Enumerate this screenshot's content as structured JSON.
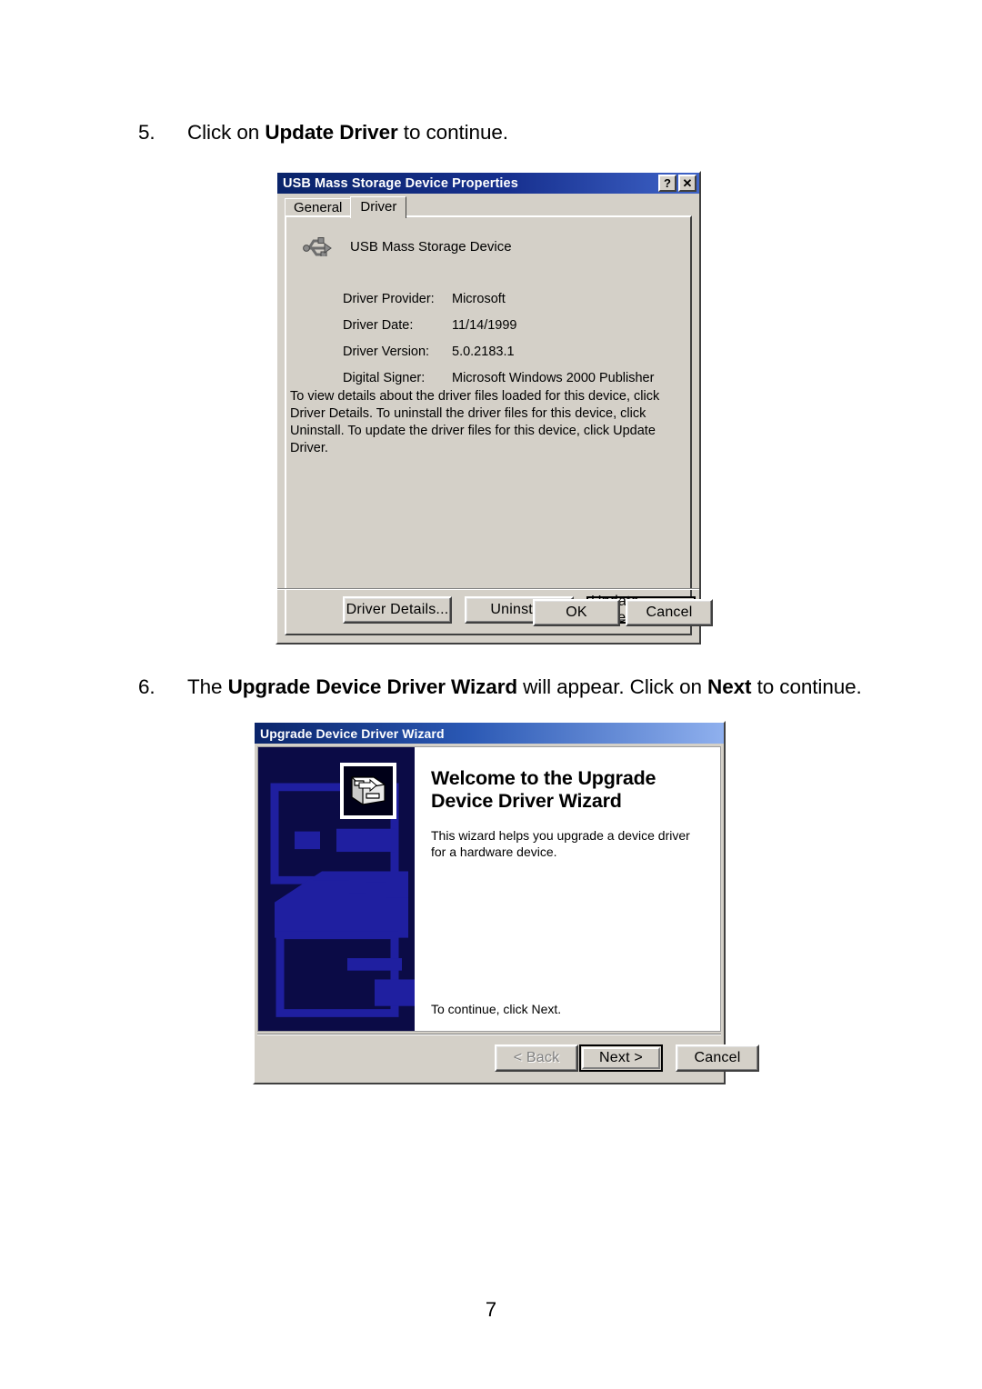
{
  "document": {
    "steps": [
      {
        "number": "5.",
        "parts": [
          {
            "text": "Click on ",
            "bold": false
          },
          {
            "text": "Update Driver",
            "bold": true
          },
          {
            "text": " to continue.",
            "bold": false
          }
        ]
      },
      {
        "number": "6.",
        "parts": [
          {
            "text": "The ",
            "bold": false
          },
          {
            "text": "Upgrade Device Driver Wizard",
            "bold": true
          },
          {
            "text": " will appear. Click on ",
            "bold": false
          },
          {
            "text": "Next",
            "bold": true
          },
          {
            "text": " to continue.",
            "bold": false
          }
        ]
      }
    ],
    "page_number": "7"
  },
  "properties_dialog": {
    "title": "USB Mass Storage Device Properties",
    "titlebar_buttons": [
      {
        "name": "help-button",
        "glyph": "?"
      },
      {
        "name": "close-button",
        "glyph": "✕"
      }
    ],
    "tabs": [
      {
        "label": "General",
        "active": false
      },
      {
        "label": "Driver",
        "active": true
      }
    ],
    "device_icon": "usb-icon",
    "device_name": "USB Mass Storage Device",
    "properties": [
      {
        "key": "Driver Provider:",
        "value": "Microsoft"
      },
      {
        "key": "Driver Date:",
        "value": "11/14/1999"
      },
      {
        "key": "Driver Version:",
        "value": "5.0.2183.1"
      },
      {
        "key": "Digital Signer:",
        "value": "Microsoft Windows 2000 Publisher"
      }
    ],
    "description": "To view details about the driver files loaded for this device, click Driver Details. To uninstall the driver files for this device, click Uninstall. To update the driver files for this device, click Update Driver.",
    "action_buttons": [
      {
        "label": "Driver Details...",
        "focused": false
      },
      {
        "label": "Uninstall",
        "focused": false
      },
      {
        "label": "Update Driver...",
        "focused": true
      }
    ],
    "commit_buttons": [
      {
        "label": "OK"
      },
      {
        "label": "Cancel"
      }
    ]
  },
  "wizard_dialog": {
    "title": "Upgrade Device Driver Wizard",
    "banner_icon": "device-driver-icon",
    "heading": "Welcome to the Upgrade Device Driver Wizard",
    "body": "This wizard helps you upgrade a device driver for a hardware device.",
    "footnote": "To continue, click Next.",
    "buttons": [
      {
        "label": "< Back",
        "state": "disabled"
      },
      {
        "label": "Next >",
        "state": "default"
      },
      {
        "label": "Cancel",
        "state": "normal"
      }
    ]
  },
  "colors": {
    "titlebar_start": "#0a246a",
    "titlebar_end": "#3f64c8",
    "dialog_face": "#d4d0c8",
    "banner_bg": "#0b0b46",
    "banner_art": "#1f1fa0"
  }
}
